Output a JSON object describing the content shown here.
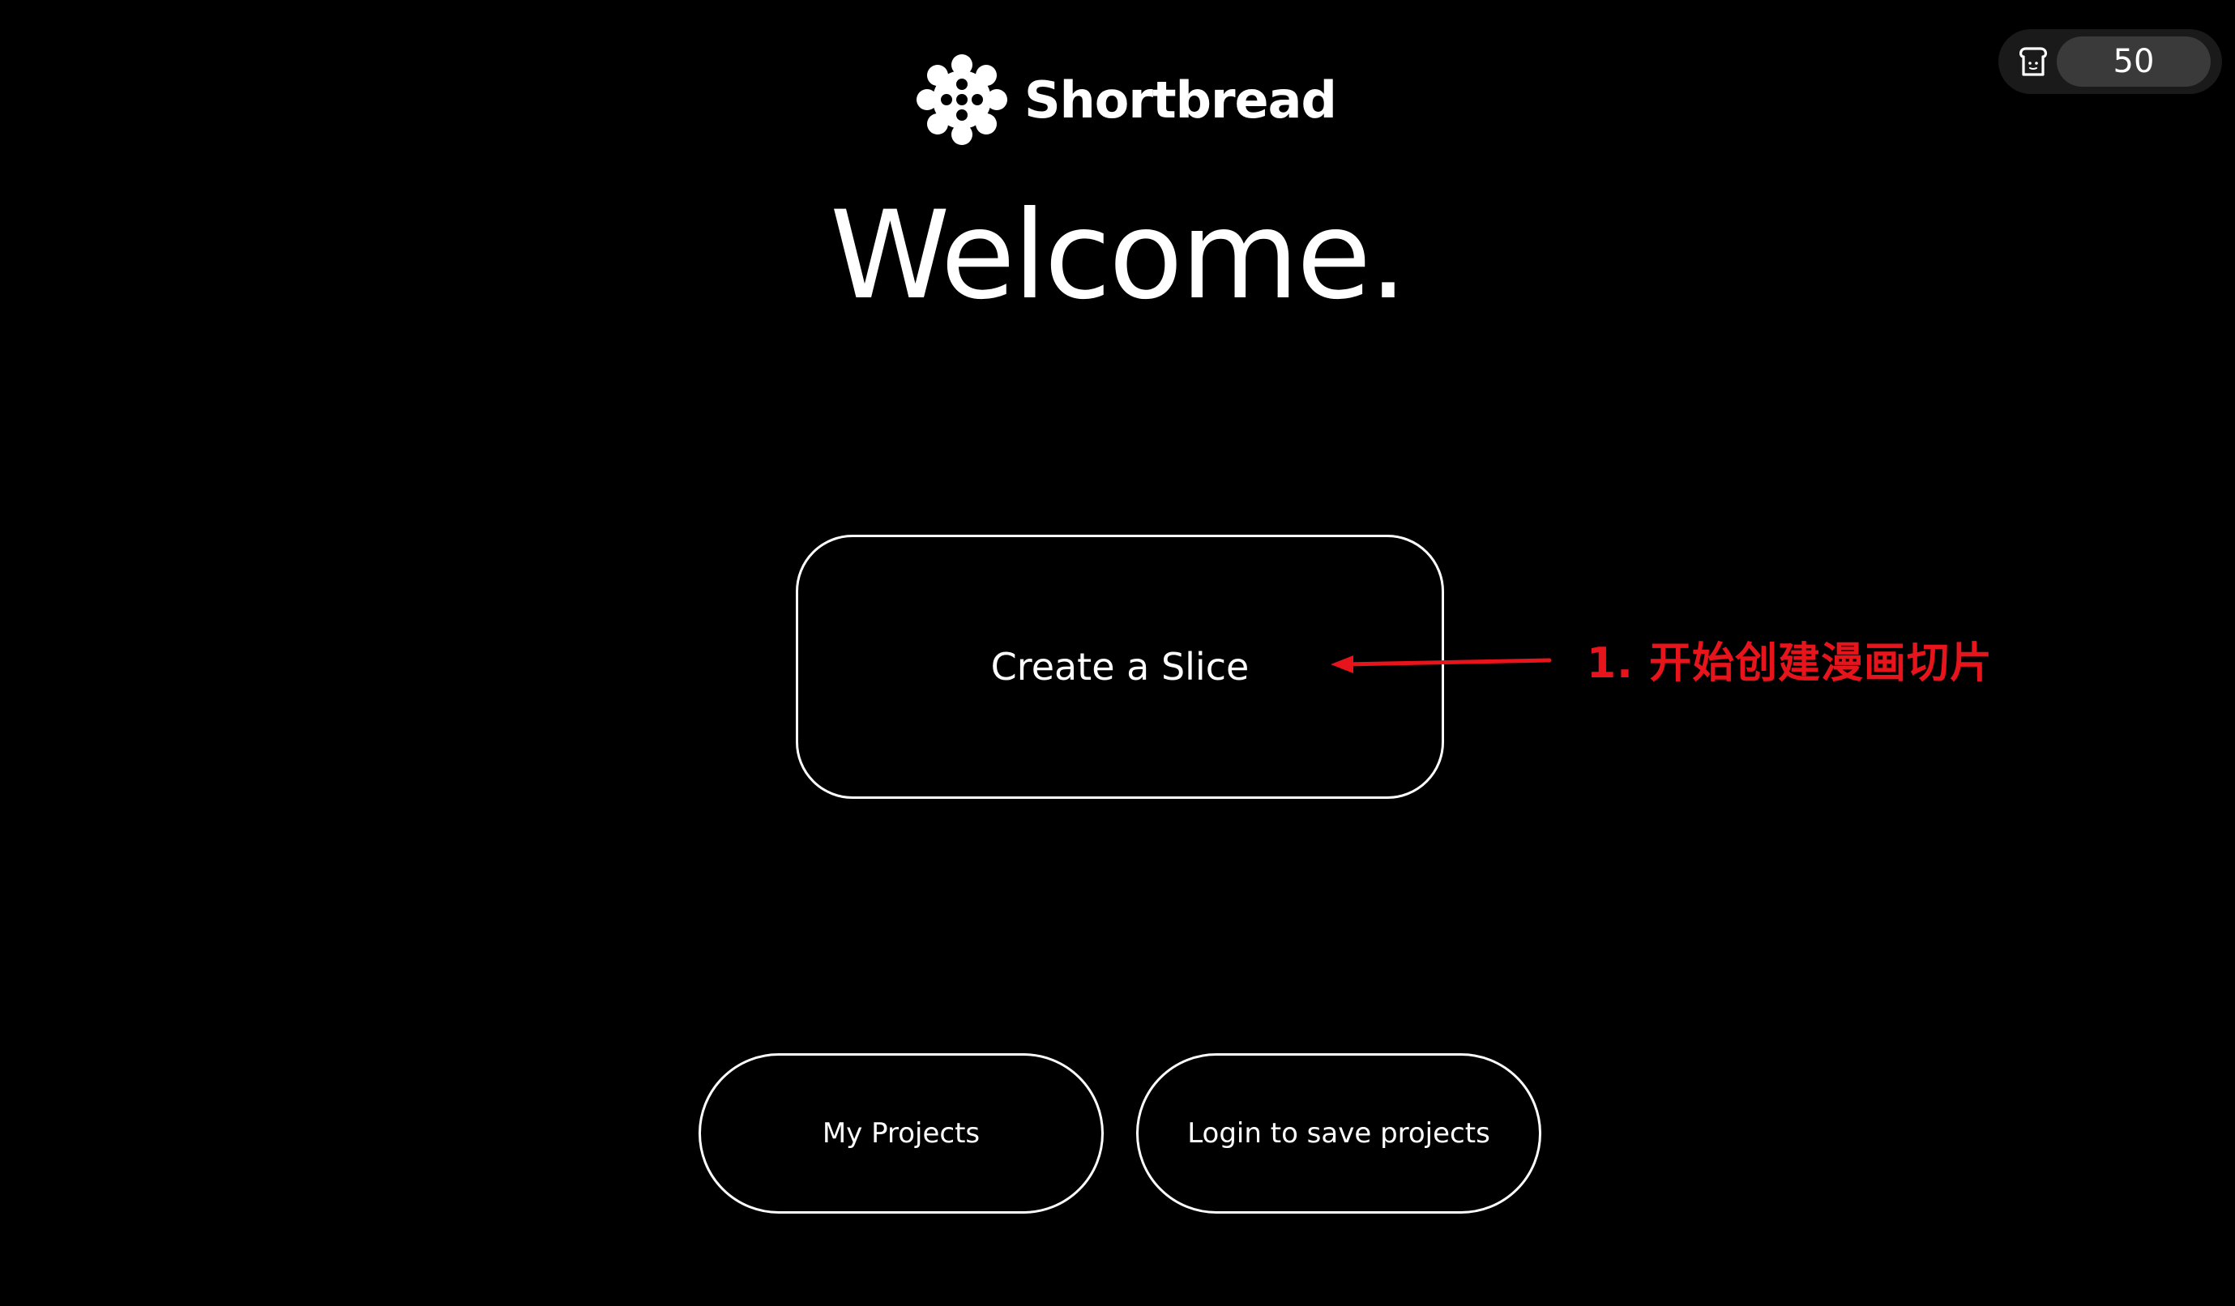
{
  "header": {
    "brand_name": "Shortbread",
    "logo_icon": "shortbread-cookie-logo",
    "credits": {
      "icon": "toast-icon",
      "count": "50"
    }
  },
  "main": {
    "title": "Welcome.",
    "create_button_label": "Create a Slice",
    "my_projects_label": "My Projects",
    "login_label": "Login to save projects"
  },
  "annotation": {
    "text": "1. 开始创建漫画切片",
    "color": "#e8141b"
  },
  "colors": {
    "background": "#000000",
    "foreground": "#ffffff",
    "credits_bg": "#1a1a1a",
    "credits_pill": "#3a3a3a"
  }
}
